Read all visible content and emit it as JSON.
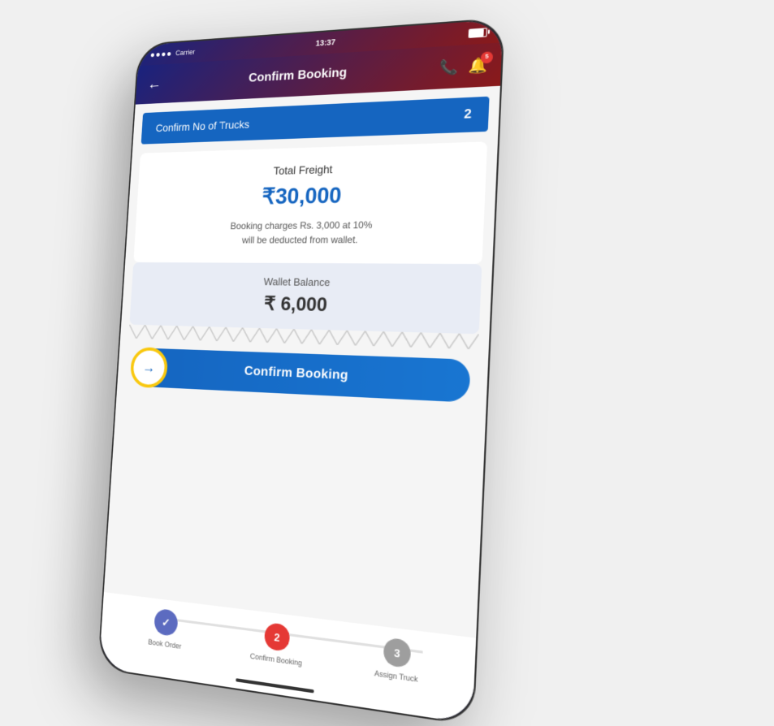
{
  "status_bar": {
    "carrier": "Carrier",
    "time": "13:37",
    "signal_dots": 4
  },
  "header": {
    "title": "Confirm Booking",
    "back_icon": "←",
    "phone_icon": "📞",
    "notification_icon": "🔔",
    "notification_badge": "5"
  },
  "trucks_bar": {
    "label": "Confirm No of Trucks",
    "count": "2"
  },
  "freight": {
    "label": "Total Freight",
    "amount": "₹30,000",
    "charges_text": "Booking charges Rs. 3,000 at 10%",
    "charges_text2": "will be deducted from wallet."
  },
  "wallet": {
    "label": "Wallet Balance",
    "amount": "₹  6,000"
  },
  "confirm_button": {
    "label": "Confirm Booking",
    "arrow": "→"
  },
  "stepper": {
    "steps": [
      {
        "id": 1,
        "label": "Book Order",
        "state": "done",
        "icon": "✓"
      },
      {
        "id": 2,
        "label": "Confirm Booking",
        "state": "active",
        "number": "2"
      },
      {
        "id": 3,
        "label": "Assign Truck",
        "state": "inactive",
        "number": "3"
      }
    ]
  }
}
